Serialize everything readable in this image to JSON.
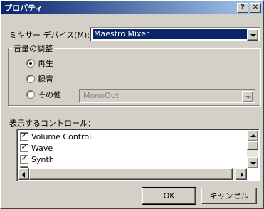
{
  "window": {
    "title": "プロパティ",
    "help_label": "?",
    "close_label": "✕"
  },
  "mixer": {
    "label": "ミキサー デバイス(M):",
    "value": "Maestro Mixer"
  },
  "volume_group": {
    "title": "音量の調整",
    "options": [
      {
        "label": "再生",
        "selected": true
      },
      {
        "label": "録音",
        "selected": false
      },
      {
        "label": "その他",
        "selected": false
      }
    ],
    "other_device": "MonoOut"
  },
  "controls": {
    "label": "表示するコントロール：",
    "items": [
      {
        "label": "Volume Control",
        "checked": true
      },
      {
        "label": "Wave",
        "checked": true
      },
      {
        "label": "Synth",
        "checked": true
      },
      {
        "label": "Line",
        "checked": false
      }
    ]
  },
  "buttons": {
    "ok": "OK",
    "cancel": "キャンセル"
  },
  "colors": {
    "titlebar_start": "#0a246a",
    "titlebar_end": "#a6caf0",
    "face": "#d4d0c8",
    "selection": "#0a246a"
  }
}
